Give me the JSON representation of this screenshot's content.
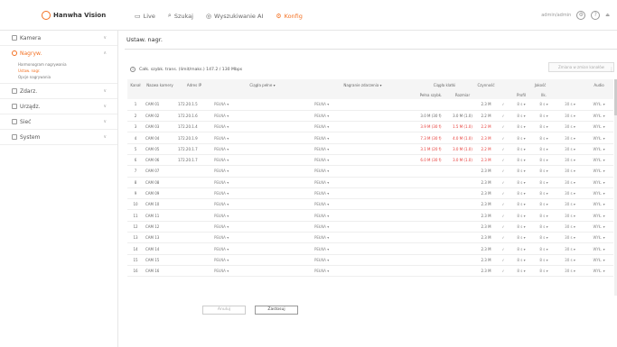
{
  "brand": {
    "name": "Hanwha Vision"
  },
  "nav": [
    {
      "label": "Live",
      "icon": "monitor-icon"
    },
    {
      "label": "Szukaj",
      "icon": "search-icon"
    },
    {
      "label": "Wyszukiwanie AI",
      "icon": "ai-search-icon"
    },
    {
      "label": "Konfig",
      "icon": "gear-icon"
    }
  ],
  "top_right": {
    "user": "admin/admin"
  },
  "sidebar": {
    "sections": [
      {
        "label": "Kamera",
        "icon": "camera-icon"
      },
      {
        "label": "Nagryw.",
        "icon": "record-icon",
        "active": true,
        "sub": [
          "Harmonogram nagrywania",
          "Ustaw. nagr.",
          "Opcje nagrywania"
        ]
      },
      {
        "label": "Zdarz.",
        "icon": "event-icon"
      },
      {
        "label": "Urządz.",
        "icon": "device-icon"
      },
      {
        "label": "Sieć",
        "icon": "network-icon"
      },
      {
        "label": "System",
        "icon": "system-icon"
      }
    ]
  },
  "main": {
    "title": "Ustaw. nagr.",
    "info_text": "Całk. szybk. trans. (limit/maks.) 147.2 / 130 Mbps",
    "top_button": "Zmiana w zmian kanałów",
    "table": {
      "headers_top": {
        "group_stream": "Ciągła klatki",
        "group_fps": "Jakość"
      },
      "headers": [
        "Kanał",
        "Nazwa kamery",
        "Adres IP",
        "Ciągła pełne ▾",
        "Nagranie zdarzenia ▾",
        "Pełna szybk.",
        "Rozmiar",
        "Czynność",
        "Profil",
        "Ilk.",
        "Audio"
      ],
      "rows": [
        {
          "ch": "1",
          "name": "CAM 01",
          "ip": "172.20.1.5",
          "cont": "PEŁNA ▾",
          "event": "PEŁNA ▾",
          "rate": "",
          "size": "",
          "q": "2.3 M",
          "red": false
        },
        {
          "ch": "2",
          "name": "CAM 02",
          "ip": "172.20.1.6",
          "cont": "PEŁNA ▾",
          "event": "PEŁNA ▾",
          "rate": "3.0 M (30 f)",
          "size": "3.0 M (1.0)",
          "q": "2.2 M",
          "red": false
        },
        {
          "ch": "3",
          "name": "CAM 03",
          "ip": "172.20.1.4",
          "cont": "PEŁNA ▾",
          "event": "PEŁNA ▾",
          "rate": "3.9 M (30 f)",
          "size": "1.5 M (1.0)",
          "q": "2.2 M",
          "red": true
        },
        {
          "ch": "4",
          "name": "CAM 04",
          "ip": "172.20.1.9",
          "cont": "PEŁNA ▾",
          "event": "PEŁNA ▾",
          "rate": "7.3 M (30 f)",
          "size": "4.0 M (1.0)",
          "q": "2.3 M",
          "red": true
        },
        {
          "ch": "5",
          "name": "CAM 05",
          "ip": "172.20.1.7",
          "cont": "PEŁNA ▾",
          "event": "PEŁNA ▾",
          "rate": "3.1 M (20 f)",
          "size": "3.0 M (1.0)",
          "q": "2.2 M",
          "red": true
        },
        {
          "ch": "6",
          "name": "CAM 06",
          "ip": "172.20.1.7",
          "cont": "PEŁNA ▾",
          "event": "PEŁNA ▾",
          "rate": "6.0 M (30 f)",
          "size": "3.0 M (1.0)",
          "q": "2.3 M",
          "red": true
        },
        {
          "ch": "7",
          "name": "CAM 07",
          "ip": "",
          "cont": "PEŁNA ▾",
          "event": "PEŁNA ▾",
          "rate": "",
          "size": "",
          "q": "2.3 M",
          "red": false
        },
        {
          "ch": "8",
          "name": "CAM 08",
          "ip": "",
          "cont": "PEŁNA ▾",
          "event": "PEŁNA ▾",
          "rate": "",
          "size": "",
          "q": "2.3 M",
          "red": false
        },
        {
          "ch": "9",
          "name": "CAM 09",
          "ip": "",
          "cont": "PEŁNA ▾",
          "event": "PEŁNA ▾",
          "rate": "",
          "size": "",
          "q": "2.3 M",
          "red": false
        },
        {
          "ch": "10",
          "name": "CAM 10",
          "ip": "",
          "cont": "PEŁNA ▾",
          "event": "PEŁNA ▾",
          "rate": "",
          "size": "",
          "q": "2.3 M",
          "red": false
        },
        {
          "ch": "11",
          "name": "CAM 11",
          "ip": "",
          "cont": "PEŁNA ▾",
          "event": "PEŁNA ▾",
          "rate": "",
          "size": "",
          "q": "2.3 M",
          "red": false
        },
        {
          "ch": "12",
          "name": "CAM 12",
          "ip": "",
          "cont": "PEŁNA ▾",
          "event": "PEŁNA ▾",
          "rate": "",
          "size": "",
          "q": "2.3 M",
          "red": false
        },
        {
          "ch": "13",
          "name": "CAM 13",
          "ip": "",
          "cont": "PEŁNA ▾",
          "event": "PEŁNA ▾",
          "rate": "",
          "size": "",
          "q": "2.3 M",
          "red": false
        },
        {
          "ch": "14",
          "name": "CAM 14",
          "ip": "",
          "cont": "PEŁNA ▾",
          "event": "PEŁNA ▾",
          "rate": "",
          "size": "",
          "q": "2.3 M",
          "red": false
        },
        {
          "ch": "15",
          "name": "CAM 15",
          "ip": "",
          "cont": "PEŁNA ▾",
          "event": "PEŁNA ▾",
          "rate": "",
          "size": "",
          "q": "2.3 M",
          "red": false
        },
        {
          "ch": "16",
          "name": "CAM 16",
          "ip": "",
          "cont": "PEŁNA ▾",
          "event": "PEŁNA ▾",
          "rate": "",
          "size": "",
          "q": "2.3 M",
          "red": false
        }
      ],
      "row_tail": {
        "check": "✓",
        "fps": "8 s ▾",
        "ilk": "30 s ▾",
        "audio": "WYŁ. ▾"
      }
    },
    "footer": {
      "cancel": "Anuluj",
      "apply": "Zastosuj"
    }
  },
  "colors": {
    "accent": "#f37021",
    "warning_text": "#e53935"
  }
}
